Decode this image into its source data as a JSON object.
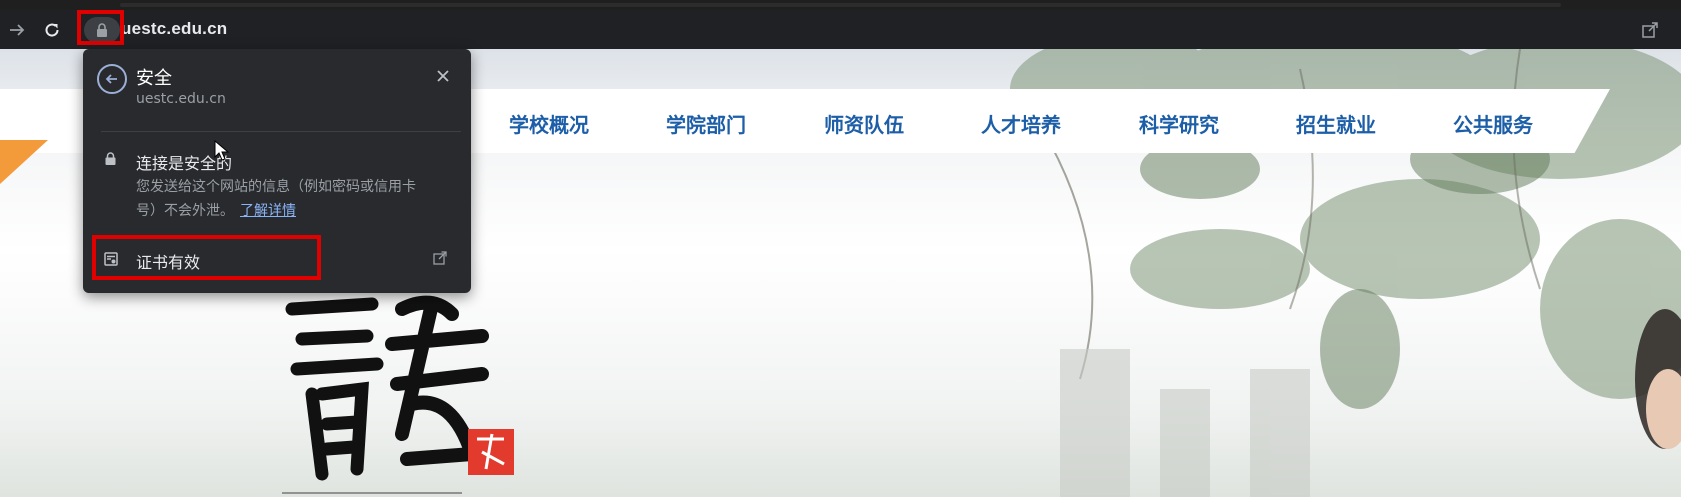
{
  "browser": {
    "url": "uestc.edu.cn",
    "icons": [
      "forward-arrow-icon",
      "reload-icon",
      "lock-icon",
      "share-icon"
    ]
  },
  "site_info_popup": {
    "title": "安全",
    "domain": "uestc.edu.cn",
    "connection_title": "连接是安全的",
    "connection_description": "您发送给这个网站的信息（例如密码或信用卡号）不会外泄。",
    "learn_more": "了解详情",
    "certificate_label": "证书有效"
  },
  "site_nav": {
    "items": [
      "学校概况",
      "学院部门",
      "师资队伍",
      "人才培养",
      "科学研究",
      "招生就业",
      "公共服务"
    ],
    "color": "#1c5ea8"
  },
  "colors": {
    "highlight": "#e00000",
    "accent_orange": "#f39a3a",
    "popup_bg": "#282a2d",
    "toolbar_bg": "#202124"
  }
}
